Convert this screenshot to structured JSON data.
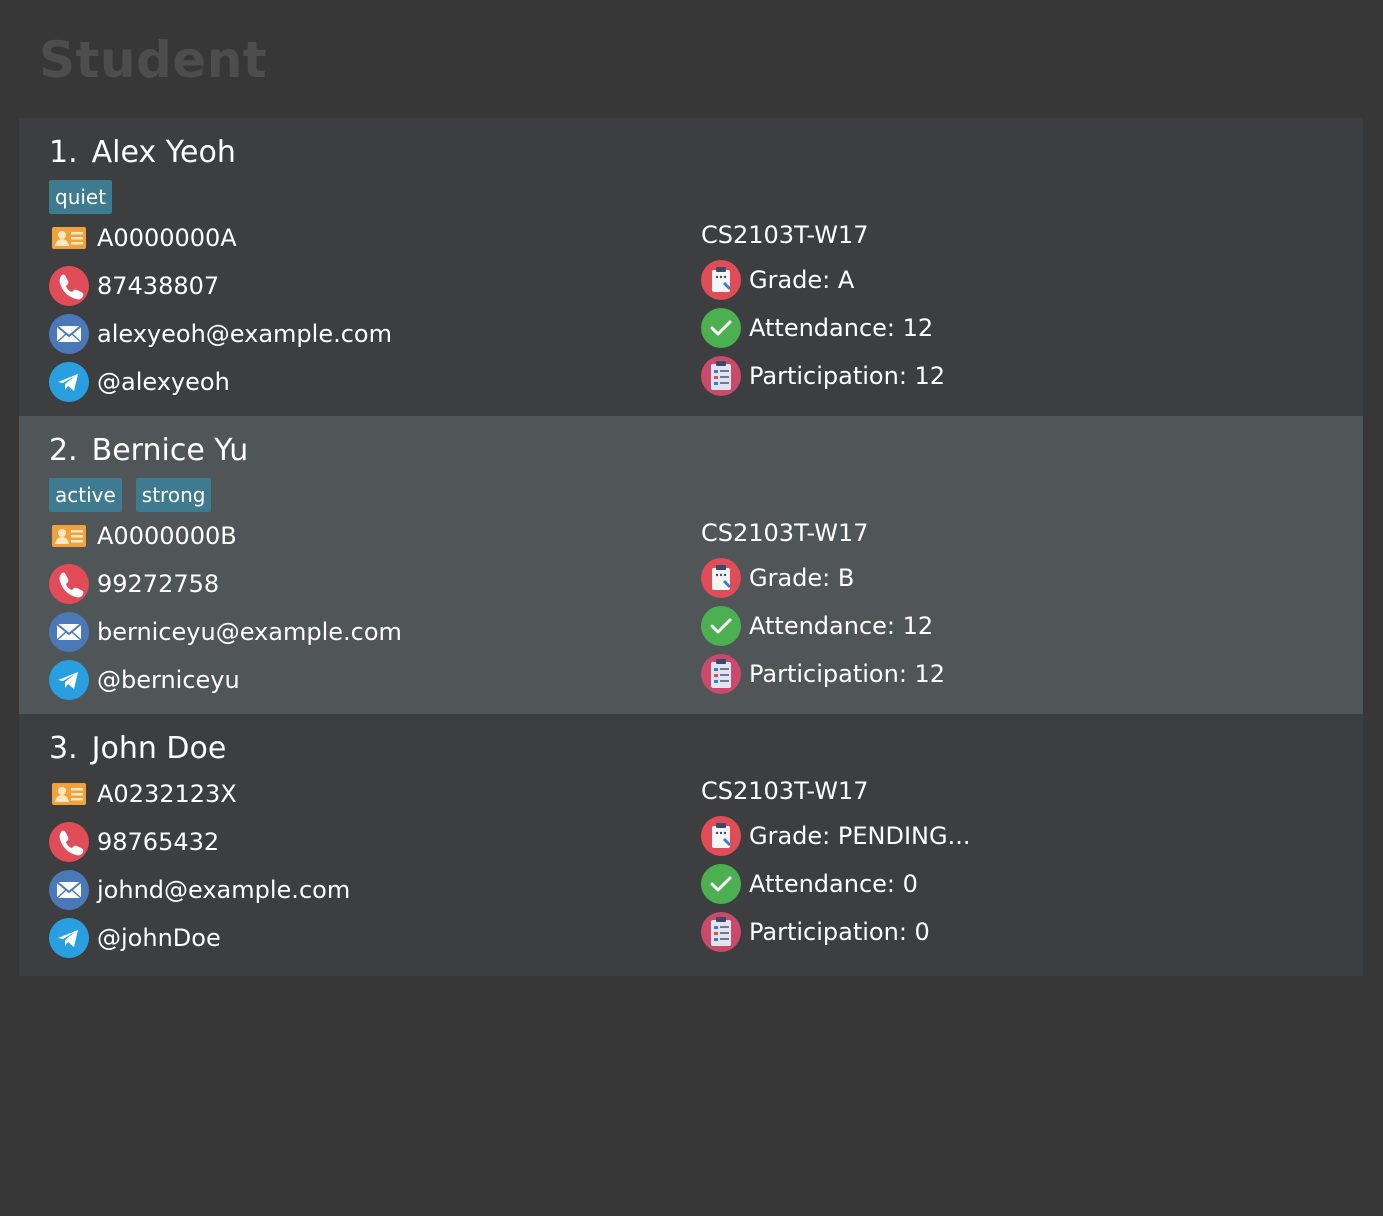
{
  "app": {
    "title": "Student"
  },
  "students": [
    {
      "index": "1.",
      "name": "Alex Yeoh",
      "tags": [
        "quiet"
      ],
      "student_id": "A0000000A",
      "phone": "87438807",
      "email": "alexyeoh@example.com",
      "telegram": "@alexyeoh",
      "group": "CS2103T-W17",
      "grade": "Grade: A",
      "attendance": "Attendance: 12",
      "participation": "Participation: 12"
    },
    {
      "index": "2.",
      "name": "Bernice Yu",
      "tags": [
        "active",
        "strong"
      ],
      "student_id": "A0000000B",
      "phone": "99272758",
      "email": "berniceyu@example.com",
      "telegram": "@berniceyu",
      "group": "CS2103T-W17",
      "grade": "Grade: B",
      "attendance": "Attendance: 12",
      "participation": "Participation: 12"
    },
    {
      "index": "3.",
      "name": "John Doe",
      "tags": [],
      "student_id": "A0232123X",
      "phone": "98765432",
      "email": "johnd@example.com",
      "telegram": "@johnDoe",
      "group": "CS2103T-W17",
      "grade": "Grade: PENDING...",
      "attendance": "Attendance: 0",
      "participation": "Participation: 0"
    }
  ],
  "selected_index": 1,
  "colors": {
    "background": "#373737",
    "card": "#3c3e3f",
    "card_selected": "#505557",
    "tag": "#3e7b91",
    "title": "#4d4d4d"
  },
  "icons": {
    "student_id": "id-card-icon",
    "phone": "phone-icon",
    "email": "email-icon",
    "telegram": "telegram-icon",
    "grade": "grade-clipboard-icon",
    "attendance": "attendance-check-icon",
    "participation": "participation-list-icon"
  }
}
